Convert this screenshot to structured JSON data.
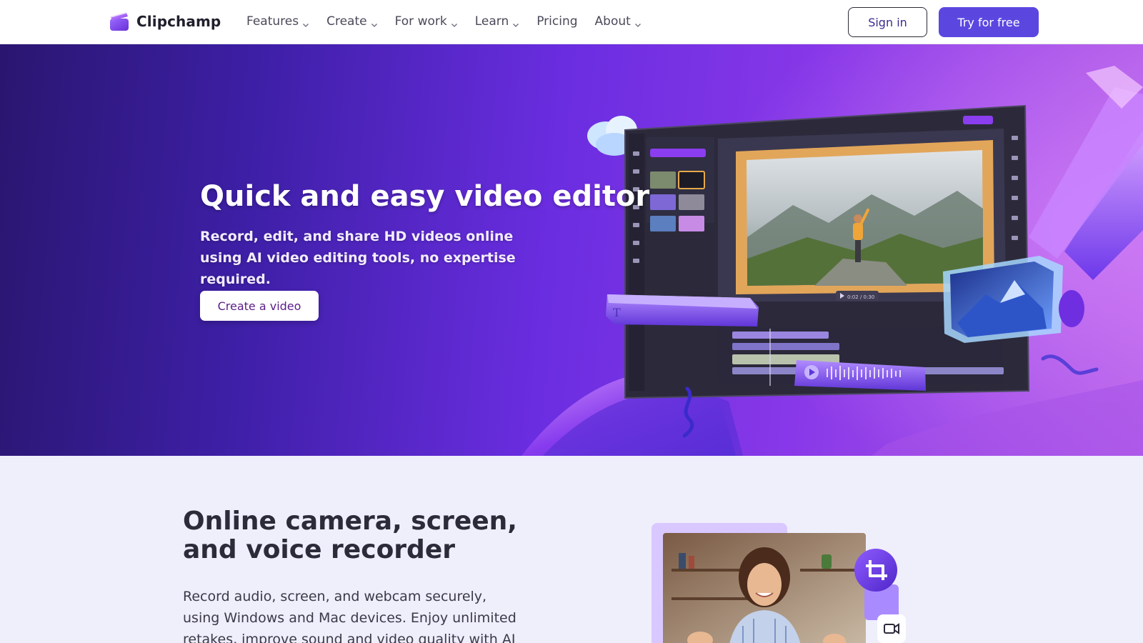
{
  "header": {
    "brand": "Clipchamp",
    "nav": [
      {
        "label": "Features",
        "has_dropdown": true
      },
      {
        "label": "Create",
        "has_dropdown": true
      },
      {
        "label": "For work",
        "has_dropdown": true
      },
      {
        "label": "Learn",
        "has_dropdown": true
      },
      {
        "label": "Pricing",
        "has_dropdown": false
      },
      {
        "label": "About",
        "has_dropdown": true
      }
    ],
    "sign_in_label": "Sign in",
    "try_label": "Try for free"
  },
  "hero": {
    "title": "Quick and easy video editor",
    "subtitle": "Record, edit, and share HD videos online using AI video editing tools, no expertise required.",
    "cta_label": "Create a video",
    "editor_timecode": "0:02 / 0:30"
  },
  "section2": {
    "title": "Online camera, screen, and voice recorder",
    "body": "Record audio, screen, and webcam securely, using Windows and Mac devices. Enjoy unlimited retakes, improve sound and video quality with AI tools, and"
  },
  "colors": {
    "brand_purple": "#5b47e0",
    "hero_start": "#2a1670",
    "hero_end": "#b35de8",
    "section_bg": "#efeefb",
    "cta_text": "#5a1d86"
  },
  "icons": [
    "clipchamp-logo-icon",
    "chevron-down-icon",
    "text-icon",
    "play-icon",
    "crop-icon",
    "camera-icon"
  ]
}
